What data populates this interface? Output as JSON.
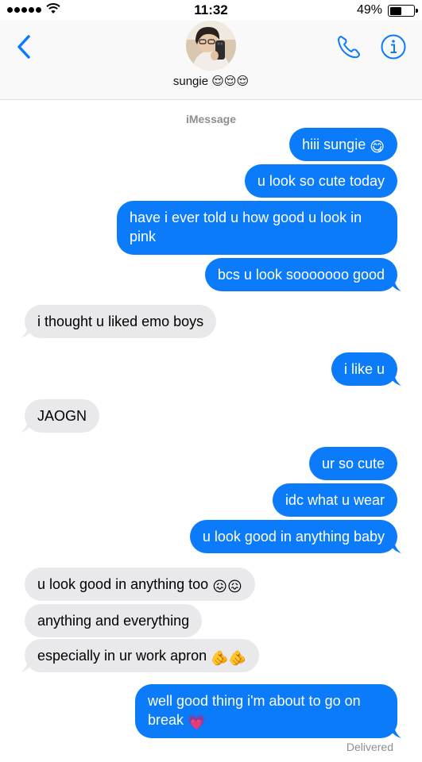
{
  "status_bar": {
    "time": "11:32",
    "battery_percent_text": "49%",
    "battery_level": 0.49,
    "signal_bars": 5
  },
  "header": {
    "contact_name": "sungie 😌😌😌",
    "back_icon": "chevron-left-icon",
    "phone_icon": "phone-icon",
    "info_icon": "info-icon"
  },
  "service_label": "iMessage",
  "messages": [
    {
      "direction": "out",
      "text": "hiii sungie",
      "emoji": "😋"
    },
    {
      "direction": "out",
      "text": "u look so cute today"
    },
    {
      "direction": "out",
      "text": "have i ever told u how good u look in pink"
    },
    {
      "direction": "out",
      "text": "bcs u look sooooooo good"
    },
    {
      "direction": "in",
      "text": "i thought u liked emo boys"
    },
    {
      "direction": "out",
      "text": "i like u"
    },
    {
      "direction": "in",
      "text": "JAOGN"
    },
    {
      "direction": "out",
      "text": "ur so cute"
    },
    {
      "direction": "out",
      "text": "idc what u wear"
    },
    {
      "direction": "out",
      "text": "u look good in anything baby"
    },
    {
      "direction": "in",
      "text": "u look good in anything too",
      "emoji": "😖😖"
    },
    {
      "direction": "in",
      "text": "anything and everything"
    },
    {
      "direction": "in",
      "text": "especially in ur work apron",
      "emoji": "🫵🫵"
    },
    {
      "direction": "out",
      "text": "well good thing i'm about to go on break",
      "emoji": "💗"
    }
  ],
  "delivered_label": "Delivered",
  "colors": {
    "outgoing_bubble": "#0b7bfa",
    "incoming_bubble": "#e9e9eb",
    "accent": "#0b7bfa",
    "meta_text": "#8e8e93"
  }
}
